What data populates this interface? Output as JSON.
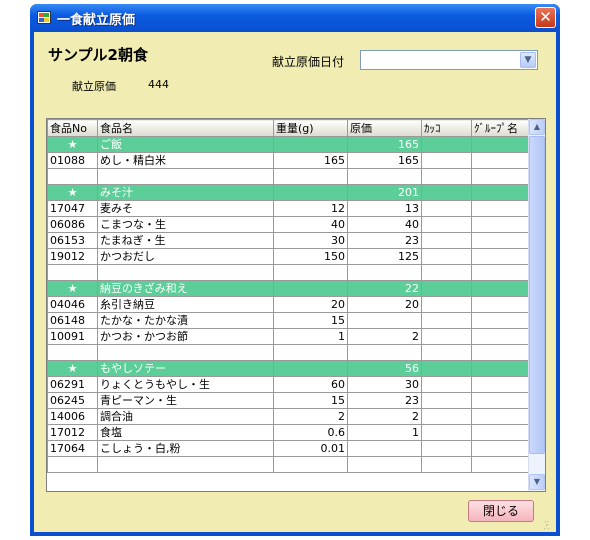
{
  "window": {
    "title": "一食献立原価",
    "close_glyph": "✕"
  },
  "menu": {
    "name": "サンプル2朝食",
    "cost_label": "献立原価",
    "cost_value": "444"
  },
  "date_filter": {
    "label": "献立原価日付",
    "value": ""
  },
  "grid": {
    "columns": [
      "食品No",
      "食品名",
      "重量(g)",
      "原価",
      "ｶｯｺ",
      "ｸﾞﾙｰﾌﾟ名"
    ],
    "rows": [
      {
        "type": "group",
        "no": "★",
        "name": "ご飯",
        "weight": "",
        "cost": "165",
        "kakko": "",
        "groupname": ""
      },
      {
        "type": "item",
        "no": "01088",
        "name": "めし・精白米",
        "weight": "165",
        "cost": "165",
        "kakko": "",
        "groupname": ""
      },
      {
        "type": "blank",
        "no": "",
        "name": "",
        "weight": "",
        "cost": "",
        "kakko": "",
        "groupname": ""
      },
      {
        "type": "group",
        "no": "★",
        "name": "みそ汁",
        "weight": "",
        "cost": "201",
        "kakko": "",
        "groupname": ""
      },
      {
        "type": "item",
        "no": "17047",
        "name": "麦みそ",
        "weight": "12",
        "cost": "13",
        "kakko": "",
        "groupname": ""
      },
      {
        "type": "item",
        "no": "06086",
        "name": "こまつな・生",
        "weight": "40",
        "cost": "40",
        "kakko": "",
        "groupname": ""
      },
      {
        "type": "item",
        "no": "06153",
        "name": "たまねぎ・生",
        "weight": "30",
        "cost": "23",
        "kakko": "",
        "groupname": ""
      },
      {
        "type": "item",
        "no": "19012",
        "name": "かつおだし",
        "weight": "150",
        "cost": "125",
        "kakko": "",
        "groupname": ""
      },
      {
        "type": "blank",
        "no": "",
        "name": "",
        "weight": "",
        "cost": "",
        "kakko": "",
        "groupname": ""
      },
      {
        "type": "group",
        "no": "★",
        "name": "納豆のきざみ和え",
        "weight": "",
        "cost": "22",
        "kakko": "",
        "groupname": ""
      },
      {
        "type": "item",
        "no": "04046",
        "name": "糸引き納豆",
        "weight": "20",
        "cost": "20",
        "kakko": "",
        "groupname": ""
      },
      {
        "type": "item",
        "no": "06148",
        "name": "たかな・たかな漬",
        "weight": "15",
        "cost": "",
        "kakko": "",
        "groupname": ""
      },
      {
        "type": "item",
        "no": "10091",
        "name": "かつお・かつお節",
        "weight": "1",
        "cost": "2",
        "kakko": "",
        "groupname": ""
      },
      {
        "type": "blank",
        "no": "",
        "name": "",
        "weight": "",
        "cost": "",
        "kakko": "",
        "groupname": ""
      },
      {
        "type": "group",
        "no": "★",
        "name": "もやしソテー",
        "weight": "",
        "cost": "56",
        "kakko": "",
        "groupname": ""
      },
      {
        "type": "item",
        "no": "06291",
        "name": "りょくとうもやし・生",
        "weight": "60",
        "cost": "30",
        "kakko": "",
        "groupname": ""
      },
      {
        "type": "item",
        "no": "06245",
        "name": "青ピーマン・生",
        "weight": "15",
        "cost": "23",
        "kakko": "",
        "groupname": ""
      },
      {
        "type": "item",
        "no": "14006",
        "name": "調合油",
        "weight": "2",
        "cost": "2",
        "kakko": "",
        "groupname": ""
      },
      {
        "type": "item",
        "no": "17012",
        "name": "食塩",
        "weight": "0.6",
        "cost": "1",
        "kakko": "",
        "groupname": ""
      },
      {
        "type": "item",
        "no": "17064",
        "name": "こしょう・白,粉",
        "weight": "0.01",
        "cost": "",
        "kakko": "",
        "groupname": ""
      },
      {
        "type": "blank",
        "no": "",
        "name": "",
        "weight": "",
        "cost": "",
        "kakko": "",
        "groupname": ""
      }
    ]
  },
  "buttons": {
    "close_label": "閉じる"
  },
  "icons": {
    "app": "app-icon",
    "dropdown": "chevron-down-icon",
    "scroll_up": "scroll-up-icon",
    "scroll_down": "scroll-down-icon",
    "grip": "size-grip-icon"
  },
  "colors": {
    "titlebar": "#0a4fd0",
    "client_bg": "#f0ecb2",
    "group_row": "#5ccf99",
    "close_button": "#f5b6bd"
  }
}
